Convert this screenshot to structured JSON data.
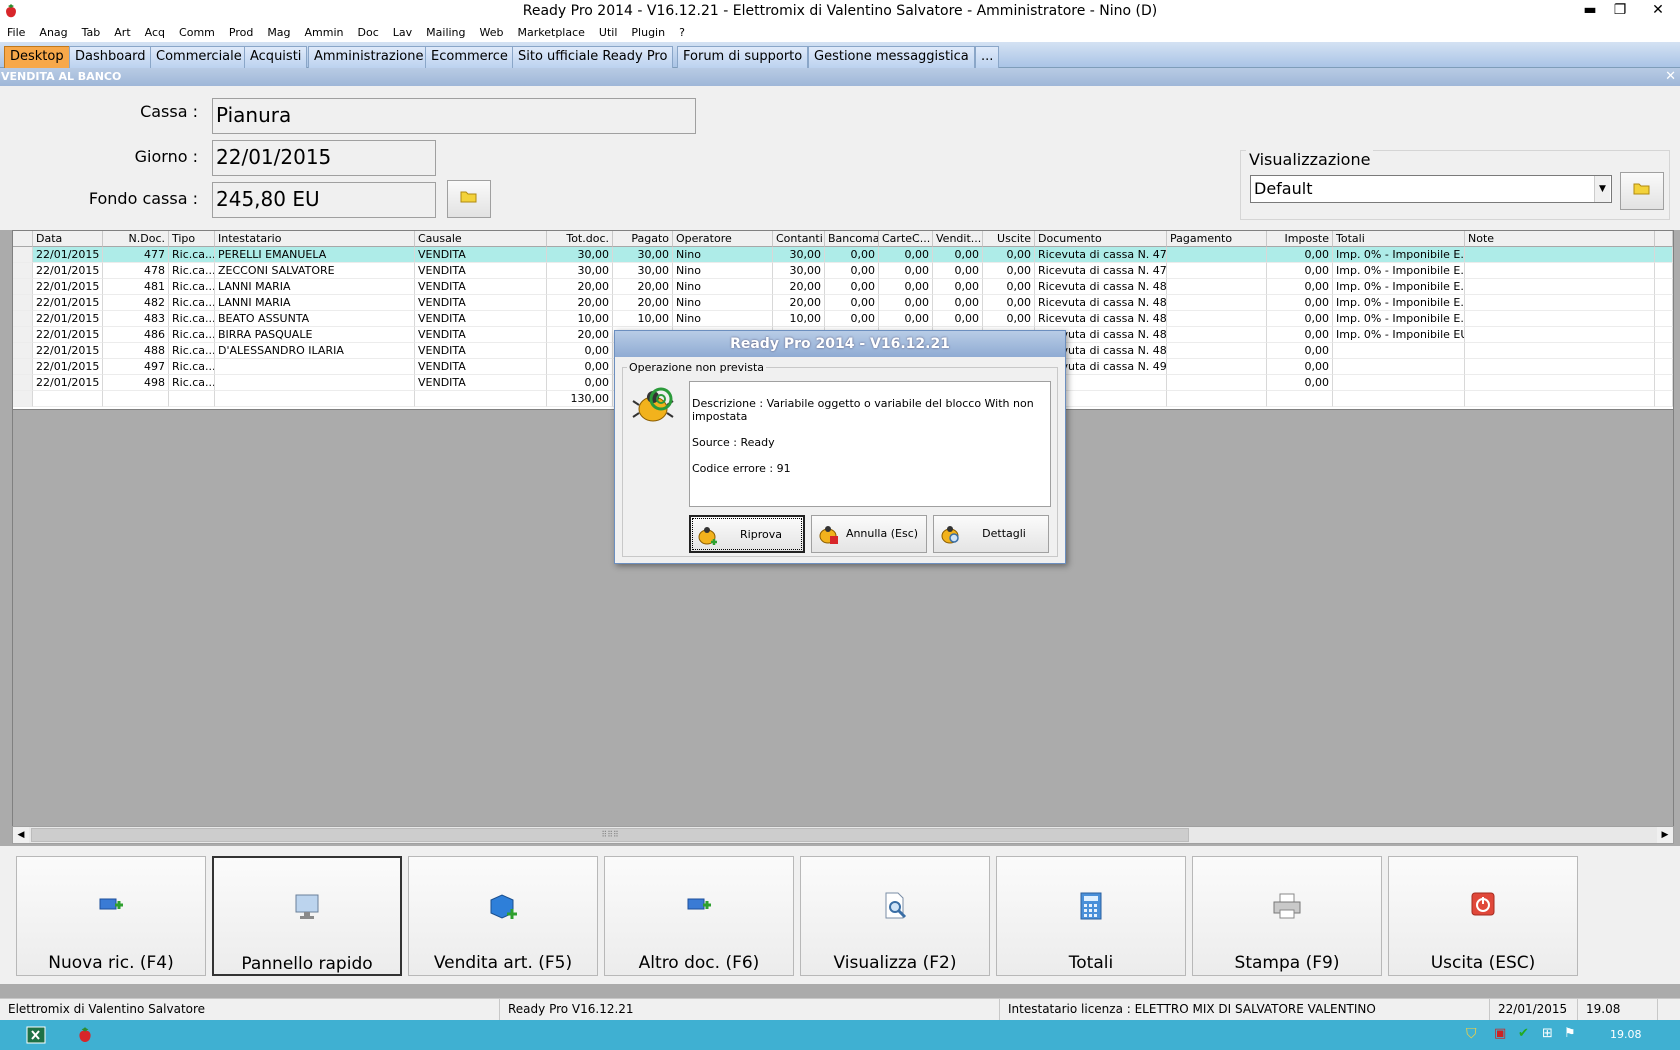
{
  "window": {
    "title": "Ready Pro 2014 - V16.12.21 - Elettromix di Valentino Salvatore - Amministratore - Nino (D)",
    "minimize": "▬",
    "restore": "❐",
    "close": "✕"
  },
  "menu": [
    "File",
    "Anag",
    "Tab",
    "Art",
    "Acq",
    "Comm",
    "Prod",
    "Mag",
    "Ammin",
    "Doc",
    "Lav",
    "Mailing",
    "Web",
    "Marketplace",
    "Util",
    "Plugin",
    "?"
  ],
  "tabs": [
    "Desktop",
    "Dashboard",
    "Commerciale",
    "Acquisti",
    "Amministrazione",
    "Ecommerce",
    "Sito ufficiale Ready Pro",
    "Forum di supporto",
    "Gestione messaggistica",
    "..."
  ],
  "section": {
    "title": "VENDITA AL BANCO",
    "close": "✕"
  },
  "form": {
    "cassa_label": "Cassa :",
    "cassa_value": "Pianura",
    "giorno_label": "Giorno :",
    "giorno_value": "22/01/2015",
    "fondo_label": "Fondo cassa :",
    "fondo_value": "245,80 EU"
  },
  "visualizzazione": {
    "legend": "Visualizzazione",
    "value": "Default"
  },
  "grid": {
    "columns": [
      "Data",
      "N.Doc.",
      "Tipo",
      "Intestatario",
      "Causale",
      "Tot.doc.",
      "Pagato",
      "Operatore",
      "Contanti",
      "Bancomat",
      "CarteC...",
      "Vendit...",
      "Uscite",
      "Documento",
      "Pagamento",
      "Imposte",
      "Totali",
      "Note"
    ],
    "rows": [
      [
        "22/01/2015",
        "477",
        "Ric.ca...",
        "PERELLI EMANUELA",
        "VENDITA",
        "30,00",
        "30,00",
        "Nino",
        "30,00",
        "0,00",
        "0,00",
        "0,00",
        "0,00",
        "Ricevuta di cassa N. 47...",
        "",
        "0,00",
        "Imp. 0% - Imponibile E...",
        ""
      ],
      [
        "22/01/2015",
        "478",
        "Ric.ca...",
        "ZECCONI SALVATORE",
        "VENDITA",
        "30,00",
        "30,00",
        "Nino",
        "30,00",
        "0,00",
        "0,00",
        "0,00",
        "0,00",
        "Ricevuta di cassa N. 47...",
        "",
        "0,00",
        "Imp. 0% - Imponibile E...",
        ""
      ],
      [
        "22/01/2015",
        "481",
        "Ric.ca...",
        "LANNI MARIA",
        "VENDITA",
        "20,00",
        "20,00",
        "Nino",
        "20,00",
        "0,00",
        "0,00",
        "0,00",
        "0,00",
        "Ricevuta di cassa N. 48...",
        "",
        "0,00",
        "Imp. 0% - Imponibile E...",
        ""
      ],
      [
        "22/01/2015",
        "482",
        "Ric.ca...",
        "LANNI MARIA",
        "VENDITA",
        "20,00",
        "20,00",
        "Nino",
        "20,00",
        "0,00",
        "0,00",
        "0,00",
        "0,00",
        "Ricevuta di cassa N. 48...",
        "",
        "0,00",
        "Imp. 0% - Imponibile E...",
        ""
      ],
      [
        "22/01/2015",
        "483",
        "Ric.ca...",
        "BEATO ASSUNTA",
        "VENDITA",
        "10,00",
        "10,00",
        "Nino",
        "10,00",
        "0,00",
        "0,00",
        "0,00",
        "0,00",
        "Ricevuta di cassa N. 48...",
        "",
        "0,00",
        "Imp. 0% - Imponibile E...",
        ""
      ],
      [
        "22/01/2015",
        "486",
        "Ric.ca...",
        "BIRRA PASQUALE",
        "VENDITA",
        "20,00",
        "",
        "",
        "",
        "",
        "",
        "",
        "",
        "Ricevuta di cassa N. 48...",
        "",
        "0,00",
        "Imp. 0% - Imponibile EU",
        ""
      ],
      [
        "22/01/2015",
        "488",
        "Ric.ca...",
        "D'ALESSANDRO ILARIA",
        "VENDITA",
        "0,00",
        "",
        "",
        "",
        "",
        "",
        "",
        "",
        "Ricevuta di cassa N. 48...",
        "",
        "0,00",
        "",
        ""
      ],
      [
        "22/01/2015",
        "497",
        "Ric.ca...",
        "",
        "VENDITA",
        "0,00",
        "",
        "",
        "",
        "",
        "",
        "",
        "",
        "Ricevuta di cassa N. 49...",
        "",
        "0,00",
        "",
        ""
      ],
      [
        "22/01/2015",
        "498",
        "Ric.ca...",
        "",
        "VENDITA",
        "0,00",
        "",
        "",
        "",
        "",
        "",
        "",
        "",
        "",
        "",
        "0,00",
        "",
        ""
      ],
      [
        "",
        "",
        "",
        "",
        "",
        "130,00",
        "",
        "",
        "",
        "",
        "",
        "",
        "",
        "",
        "",
        "",
        "",
        ""
      ]
    ]
  },
  "toolbar": [
    "Nuova ric. (F4)",
    "Pannello rapido",
    "Vendita art. (F5)",
    "Altro doc. (F6)",
    "Visualizza (F2)",
    "Totali",
    "Stampa (F9)",
    "Uscita (ESC)"
  ],
  "status": {
    "company": "Elettromix di Valentino Salvatore",
    "version": "Ready Pro V16.12.21",
    "license": "Intestatario licenza : ELETTRO MIX DI SALVATORE VALENTINO",
    "date": "22/01/2015",
    "time": "19.08"
  },
  "taskbar": {
    "clock": "19.08"
  },
  "dialog": {
    "title": "Ready Pro 2014 - V16.12.21",
    "group": "Operazione non prevista",
    "message_line1": "Descrizione : Variabile oggetto o variabile del blocco With non impostata",
    "message_line2": "Source : Ready",
    "message_line3": "Codice errore : 91",
    "buttons": [
      "Riprova",
      "Annulla (Esc)",
      "Dettagli"
    ]
  }
}
